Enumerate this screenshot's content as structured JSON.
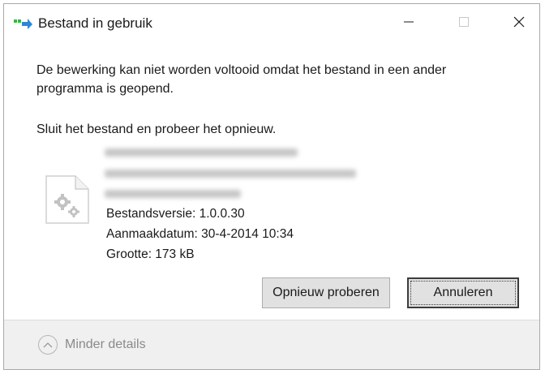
{
  "window": {
    "title": "Bestand in gebruik",
    "app_icon": "transfer-arrow-icon",
    "controls": {
      "minimize": "minimize-icon",
      "maximize": "maximize-icon",
      "close": "close-icon"
    }
  },
  "dialog": {
    "message": "De bewerking kan niet worden voltooid omdat het bestand in een ander programma is geopend.",
    "instruction": "Sluit het bestand en probeer het opnieuw.",
    "file": {
      "icon": "file-gear-icon",
      "version": "Bestandsversie: 1.0.0.30",
      "modified": "Aanmaakdatum: 30-4-2014 10:34",
      "size": "Grootte: 173 kB"
    },
    "buttons": {
      "retry": "Opnieuw proberen",
      "cancel": "Annuleren"
    }
  },
  "footer": {
    "details_label": "Minder details",
    "details_icon": "chevron-up-icon"
  },
  "colors": {
    "accent_green": "#3cb44a",
    "accent_blue": "#2f86d6",
    "footer_bg": "#f0f0f0",
    "button_bg": "#e1e1e1"
  }
}
